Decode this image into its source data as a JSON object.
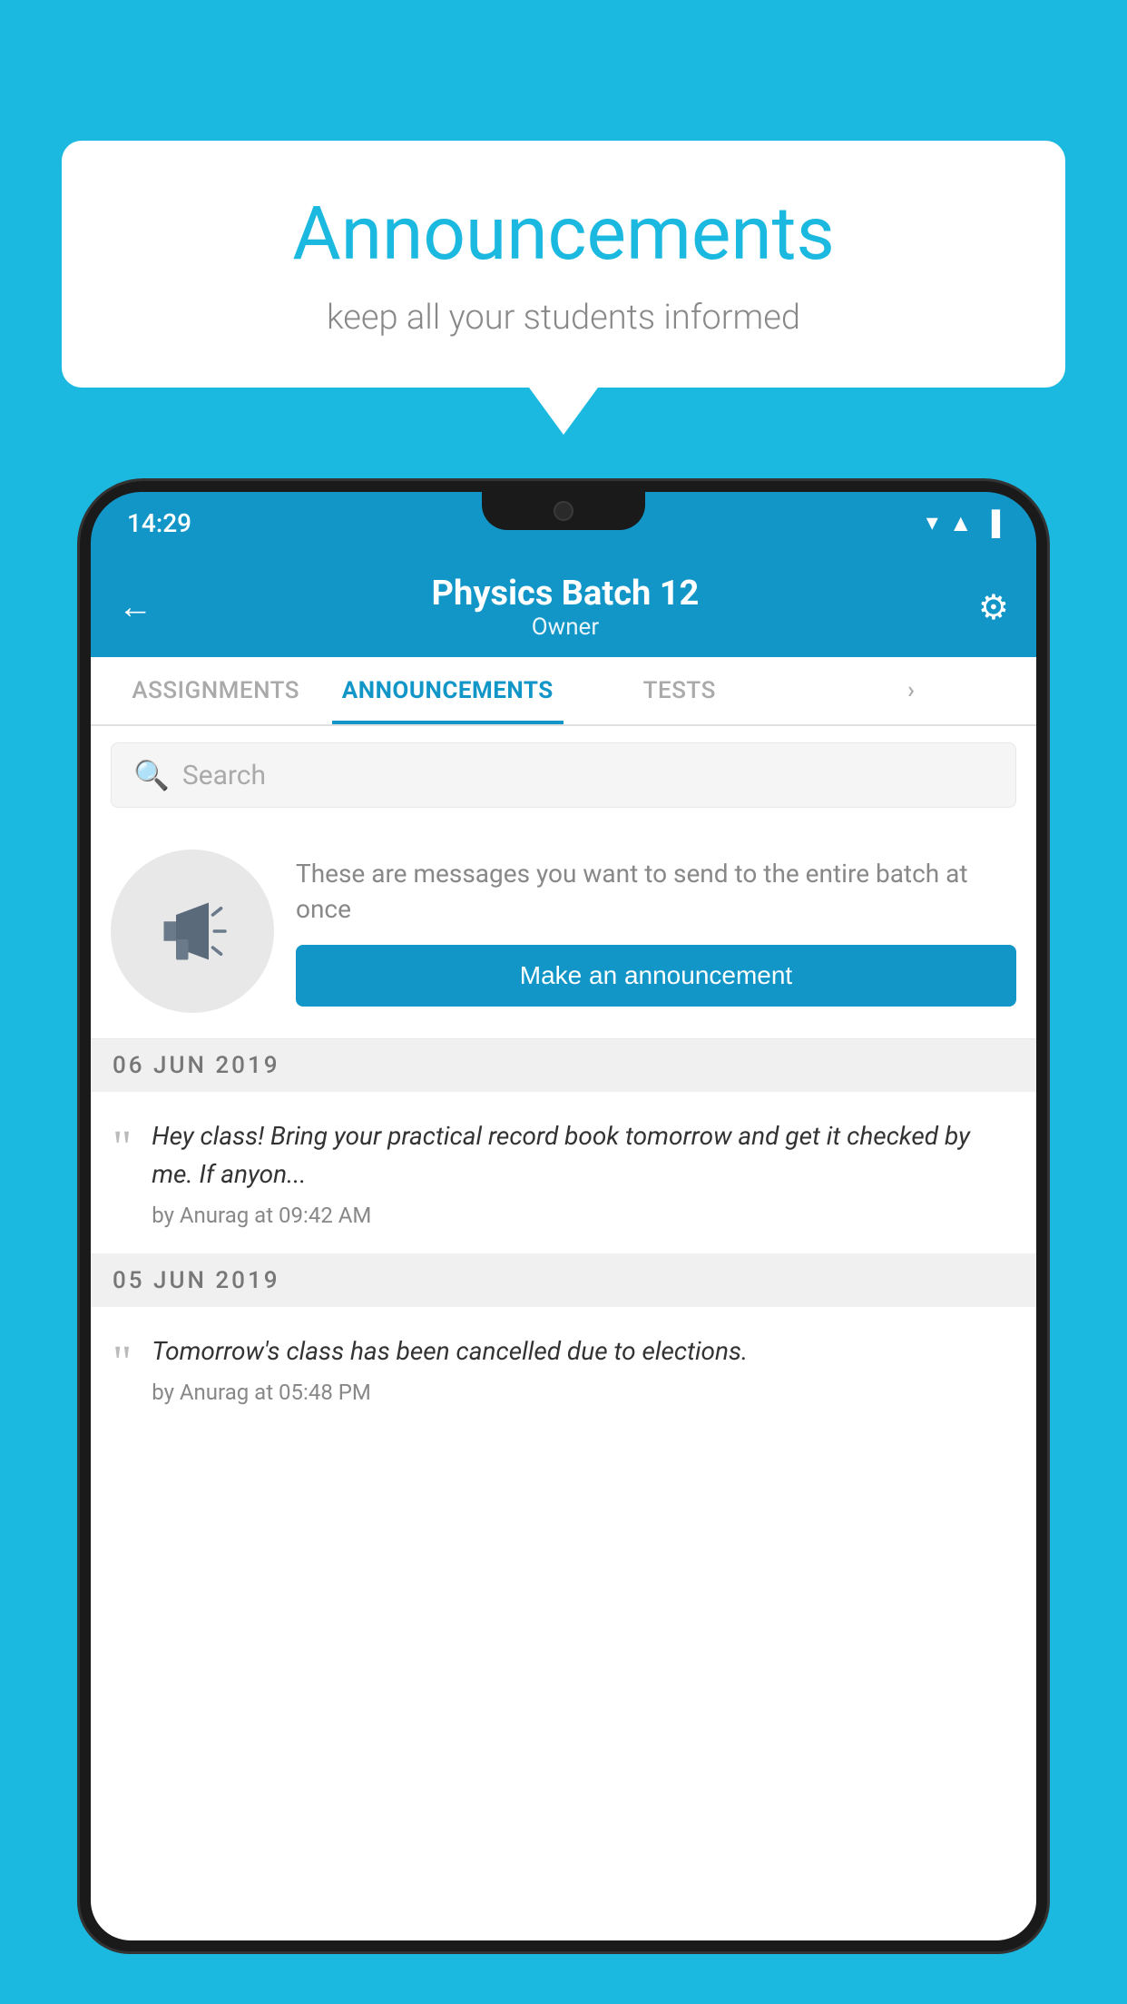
{
  "app_background_color": "#1bb8e0",
  "speech_bubble": {
    "title": "Announcements",
    "subtitle": "keep all your students informed"
  },
  "phone": {
    "status_bar": {
      "time": "14:29",
      "wifi": "▾",
      "signal": "▲",
      "battery": "▐"
    },
    "header": {
      "title": "Physics Batch 12",
      "subtitle": "Owner",
      "back_label": "←",
      "gear_label": "⚙"
    },
    "tabs": [
      {
        "label": "ASSIGNMENTS",
        "active": false
      },
      {
        "label": "ANNOUNCEMENTS",
        "active": true
      },
      {
        "label": "TESTS",
        "active": false
      },
      {
        "label": "•",
        "active": false
      }
    ],
    "search": {
      "placeholder": "Search"
    },
    "promo": {
      "description": "These are messages you want to send to the entire batch at once",
      "button_label": "Make an announcement"
    },
    "announcements": [
      {
        "date": "06  JUN  2019",
        "text": "Hey class! Bring your practical record book tomorrow and get it checked by me. If anyon...",
        "author": "by Anurag at 09:42 AM"
      },
      {
        "date": "05  JUN  2019",
        "text": "Tomorrow's class has been cancelled due to elections.",
        "author": "by Anurag at 05:48 PM"
      }
    ]
  }
}
